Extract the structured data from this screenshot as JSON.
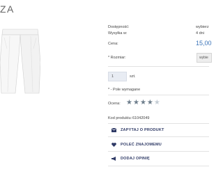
{
  "product": {
    "title_fragment": "ZA",
    "rating": 4.5
  },
  "info": {
    "availability_label": "Dostępność:",
    "availability_value": "wybierz",
    "shipping_label": "Wysyłka w:",
    "shipping_value": "4 dni",
    "price_label": "Cena:",
    "price_value": "15,00",
    "size_label": "* Rozmiar:",
    "size_value": "wybie",
    "quantity_value": "1",
    "quantity_unit": "szt.",
    "required_note": "* - Pole wymagane",
    "rating_label": "Ocena:",
    "code_label": "Kod produktu:",
    "code_value": "61042049"
  },
  "actions": {
    "ask": "ZAPYTAJ O PRODUKT",
    "recommend": "POLEĆ ZNAJOMEMU",
    "review": "DODAJ OPINIĘ"
  },
  "colors": {
    "accent": "#3a73b8",
    "action_text": "#2f3a66"
  },
  "icons": {
    "ask": "envelope-icon",
    "recommend": "heart-icon",
    "review": "megaphone-icon"
  }
}
